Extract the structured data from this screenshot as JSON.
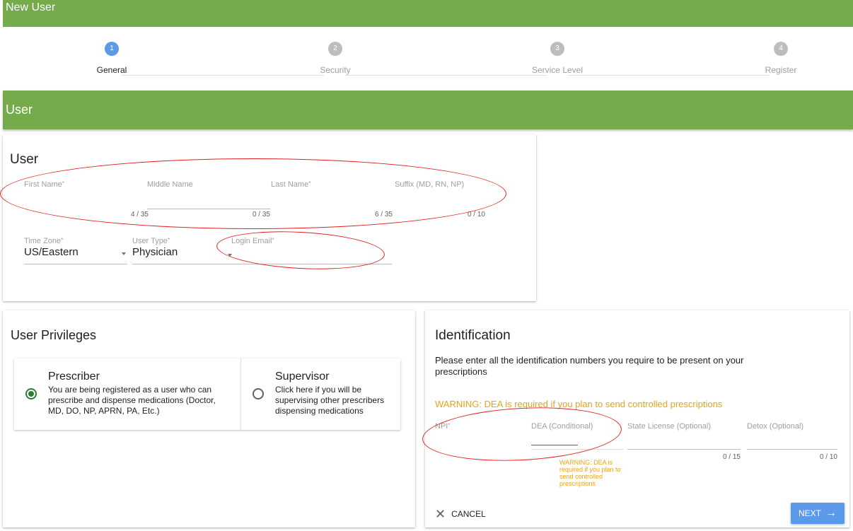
{
  "header": {
    "title": "New User"
  },
  "stepper": {
    "steps": [
      {
        "number": "1",
        "label": "General"
      },
      {
        "number": "2",
        "label": "Security"
      },
      {
        "number": "3",
        "label": "Service Level"
      },
      {
        "number": "4",
        "label": "Register"
      }
    ],
    "active_step": 1
  },
  "section": {
    "title": "User"
  },
  "user_card": {
    "title": "User",
    "required_mark": "*",
    "first_name": {
      "label": "First Name",
      "counter": "4 / 35",
      "value": ""
    },
    "middle_name": {
      "label": "Middle Name",
      "counter": "0 / 35",
      "value": ""
    },
    "last_name": {
      "label": "Last Name",
      "counter": "6 / 35",
      "value": ""
    },
    "suffix": {
      "label": "Suffix (MD, RN, NP)",
      "counter": "0 / 10",
      "value": ""
    },
    "time_zone": {
      "label": "Time Zone",
      "value": "US/Eastern"
    },
    "user_type": {
      "label": "User Type",
      "value": "Physician"
    },
    "login_email": {
      "label": "Login Email",
      "value": ""
    }
  },
  "privileges_card": {
    "title": "User Privileges",
    "options": [
      {
        "title": "Prescriber",
        "description": "You are being registered as a user who can prescribe and dispense medications (Doctor, MD, DO, NP, APRN, PA, Etc.)",
        "selected": true
      },
      {
        "title": "Supervisor",
        "description": "Click here if you will be supervising other prescribers dispensing medications",
        "selected": false
      }
    ]
  },
  "identification_card": {
    "title": "Identification",
    "intro": "Please enter all the identification numbers you require to be present on your prescriptions",
    "warning": "WARNING: DEA is required if you plan to send controlled prescriptions",
    "npi": {
      "label": "NPI",
      "value": ""
    },
    "dea": {
      "label": "DEA (Conditional)",
      "value": "",
      "warning": "WARNING: DEA is required if you plan to send controlled prescriptions"
    },
    "state_license": {
      "label": "State License (Optional)",
      "counter": "0 / 15",
      "value": ""
    },
    "detox": {
      "label": "Detox (Optional)",
      "counter": "0 / 10",
      "value": ""
    },
    "cancel_label": "CANCEL",
    "next_label": "NEXT"
  },
  "colors": {
    "brand_green": "#76ab4b",
    "accent_blue": "#5b9ae9",
    "warning_orange": "#e8a317",
    "annotation_red": "#e02020"
  },
  "icons": {
    "cancel": "close-icon",
    "next": "arrow-right-icon",
    "dropdown": "caret-down-icon"
  }
}
